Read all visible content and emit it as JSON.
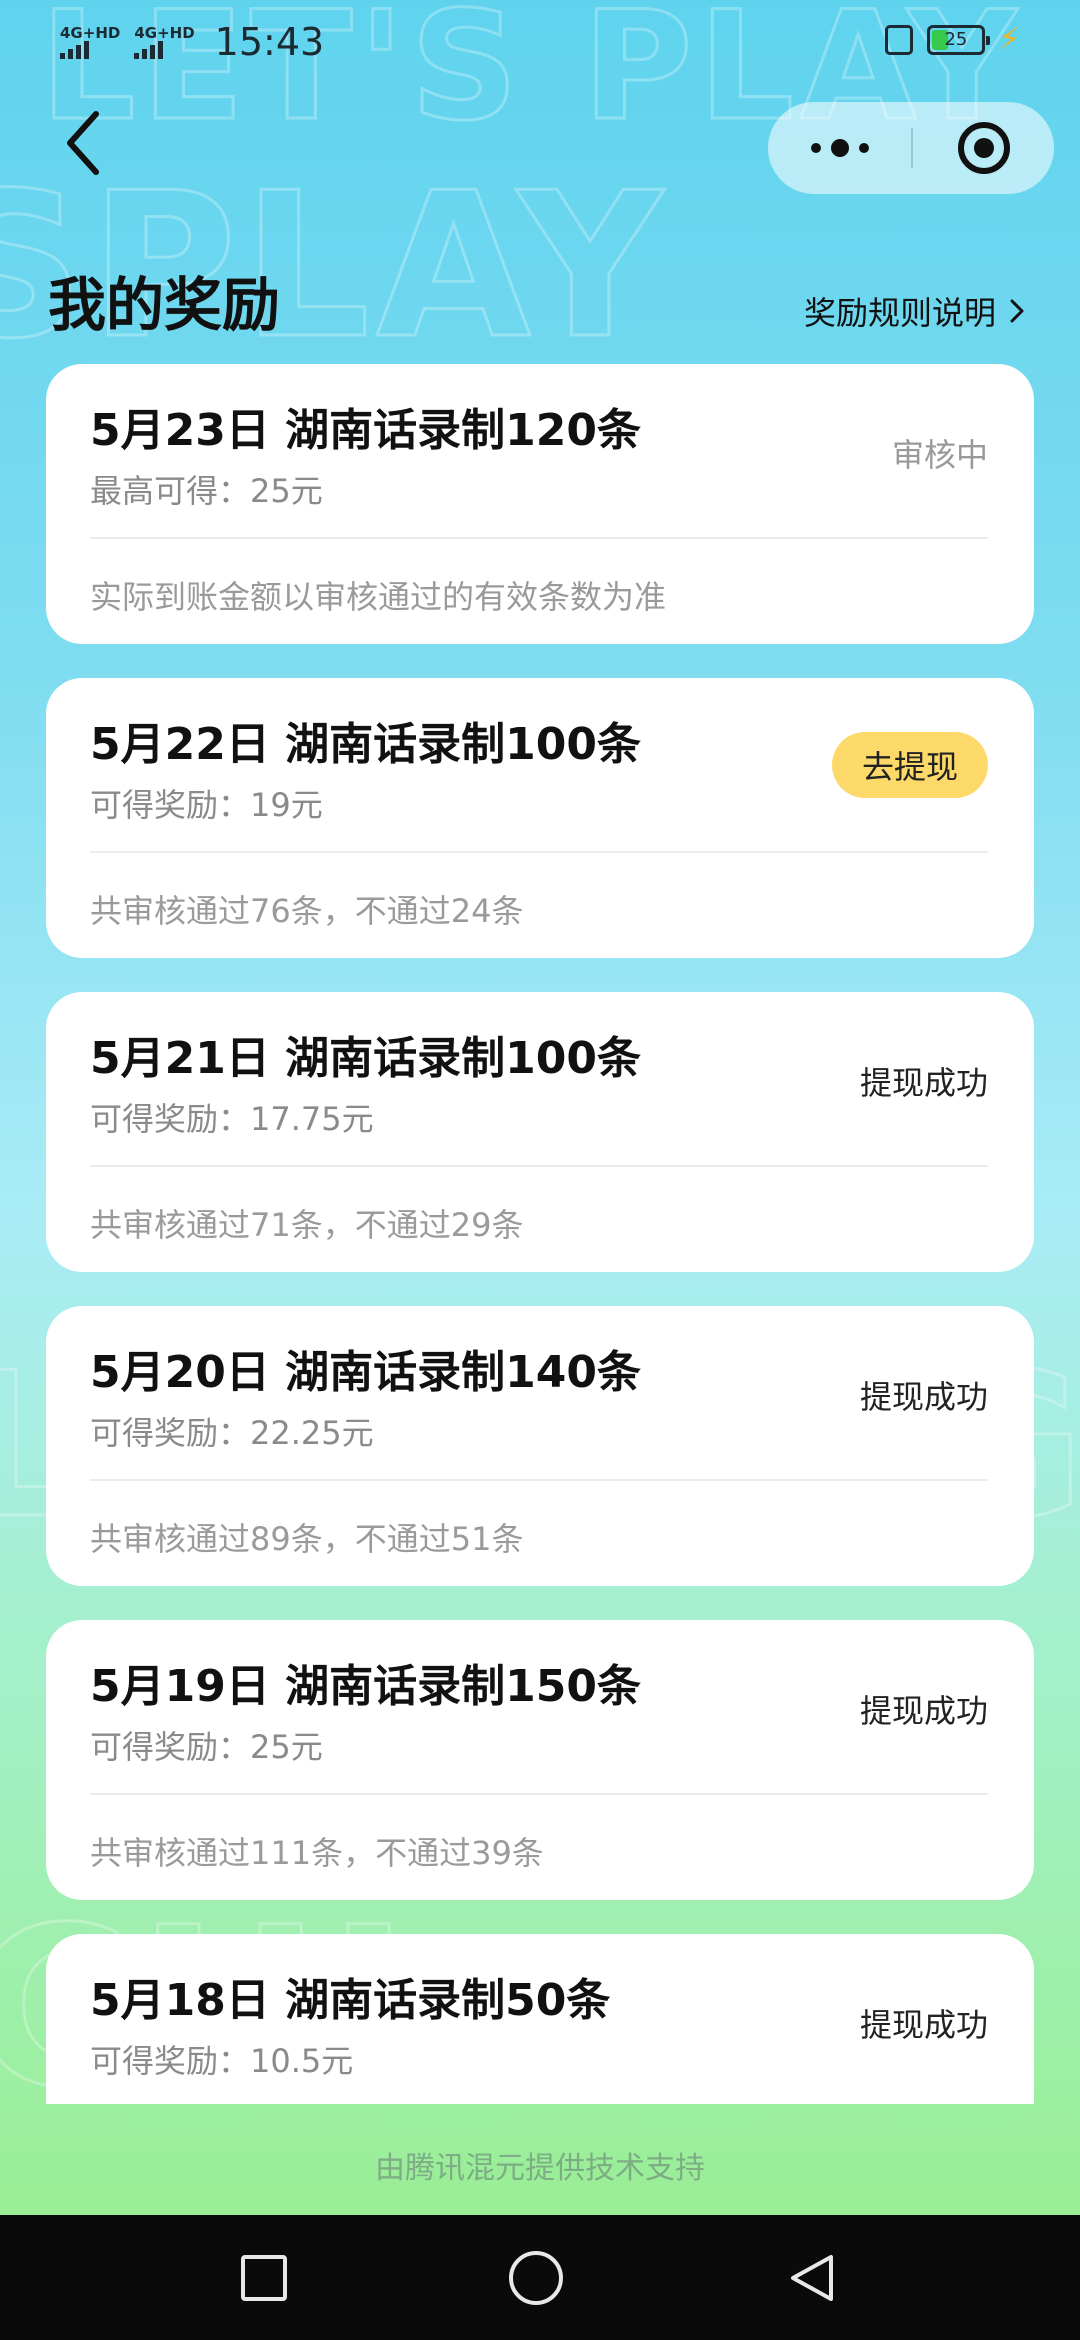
{
  "status_bar": {
    "network1": "4G+HD",
    "network2": "4G+HD",
    "time": "15:43",
    "battery": "25"
  },
  "header": {
    "title": "我的奖励",
    "rules_link": "奖励规则说明"
  },
  "background_text": [
    "LET'S PLAY",
    "SPLAY",
    "LANGUAGE",
    "CHI"
  ],
  "cards": [
    {
      "title": "5月23日 湖南话录制120条",
      "sub": "最高可得：25元",
      "status": "审核中",
      "note": "实际到账金额以审核通过的有效条数为准"
    },
    {
      "title": "5月22日 湖南话录制100条",
      "sub": "可得奖励：19元",
      "status": "去提现",
      "note": "共审核通过76条，不通过24条"
    },
    {
      "title": "5月21日 湖南话录制100条",
      "sub": "可得奖励：17.75元",
      "status": "提现成功",
      "note": "共审核通过71条，不通过29条"
    },
    {
      "title": "5月20日 湖南话录制140条",
      "sub": "可得奖励：22.25元",
      "status": "提现成功",
      "note": "共审核通过89条，不通过51条"
    },
    {
      "title": "5月19日 湖南话录制150条",
      "sub": "可得奖励：25元",
      "status": "提现成功",
      "note": "共审核通过111条，不通过39条"
    },
    {
      "title": "5月18日 湖南话录制50条",
      "sub": "可得奖励：10.5元",
      "status": "提现成功"
    }
  ],
  "footer": "由腾讯混元提供技术支持",
  "colors": {
    "withdraw_button": "#fcd968",
    "card_bg": "#ffffff",
    "bg_top": "#5fd3ee",
    "bg_bottom": "#98ee88"
  }
}
